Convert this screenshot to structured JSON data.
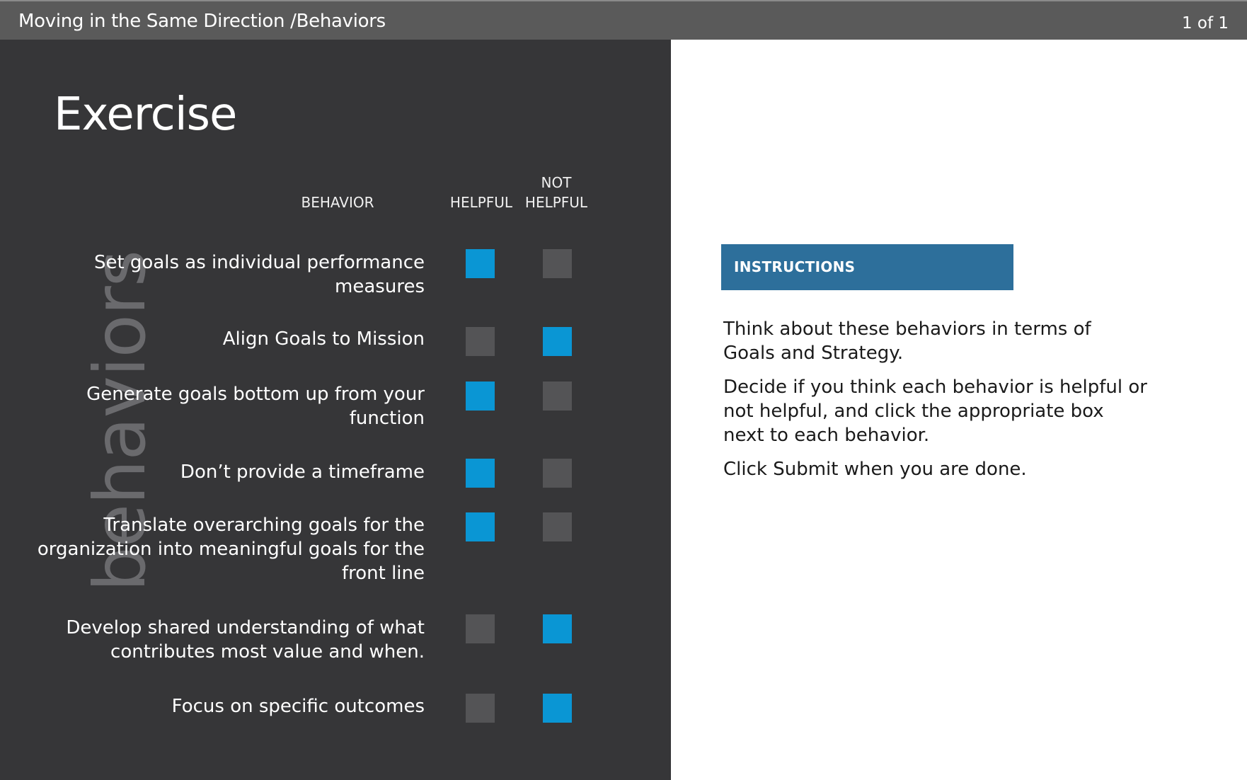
{
  "header": {
    "breadcrumb": "Moving in the Same Direction /Behaviors",
    "page_indicator": "1 of 1"
  },
  "exercise": {
    "title": "Exercise",
    "side_label": "behaviors",
    "columns": {
      "behavior": "BEHAVIOR",
      "helpful": "HELPFUL",
      "not_helpful_line1": "NOT",
      "not_helpful_line2": "HELPFUL"
    },
    "behaviors": [
      {
        "label": "Set goals as individual performance measures",
        "helpful_selected": true,
        "not_helpful_selected": false
      },
      {
        "label": "Align Goals to Mission",
        "helpful_selected": false,
        "not_helpful_selected": true
      },
      {
        "label": "Generate goals bottom up from your function",
        "helpful_selected": true,
        "not_helpful_selected": false
      },
      {
        "label": "Don’t provide a timeframe",
        "helpful_selected": true,
        "not_helpful_selected": false
      },
      {
        "label": "Translate overarching goals for the organization into meaningful goals for the front line",
        "helpful_selected": true,
        "not_helpful_selected": false
      },
      {
        "label": "Develop shared understanding of what contributes most value and when.",
        "helpful_selected": false,
        "not_helpful_selected": true
      },
      {
        "label": "Focus on specific outcomes",
        "helpful_selected": false,
        "not_helpful_selected": true
      }
    ]
  },
  "instructions": {
    "header": "INSTRUCTIONS",
    "paragraphs": [
      "Think about these behaviors in terms of Goals and Strategy.",
      "Decide if you think each behavior is helpful or not helpful, and click the appropriate box next to each behavior.",
      "Click Submit when you are done."
    ]
  },
  "colors": {
    "top_bar": "#5a5a5a",
    "left_panel": "#363638",
    "box_selected": "#0a96d4",
    "box_unselected": "#545456",
    "instructions_header": "#2d6f9b"
  }
}
